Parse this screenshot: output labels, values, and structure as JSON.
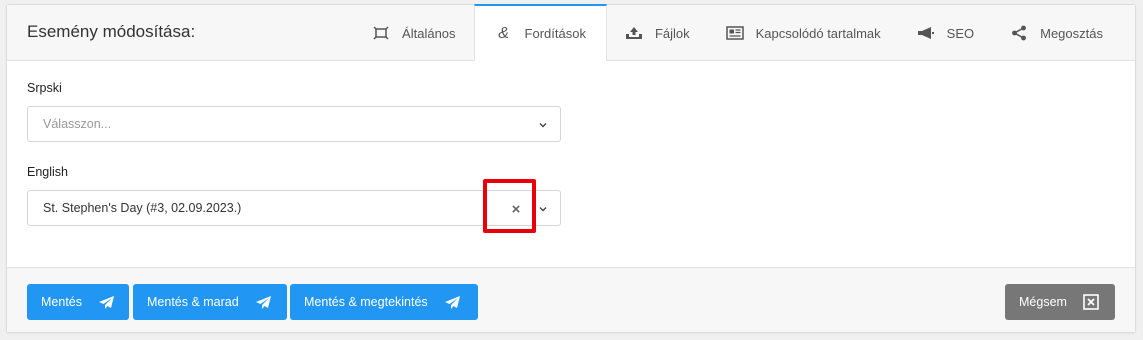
{
  "header": {
    "title": "Esemény módosítása:",
    "tabs": [
      {
        "label": "Általános",
        "icon": "expand-frame-icon",
        "active": false
      },
      {
        "label": "Fordítások",
        "icon": "ampersand-icon",
        "active": true
      },
      {
        "label": "Fájlok",
        "icon": "upload-icon",
        "active": false
      },
      {
        "label": "Kapcsolódó tartalmak",
        "icon": "newspaper-icon",
        "active": false
      },
      {
        "label": "SEO",
        "icon": "megaphone-icon",
        "active": false
      },
      {
        "label": "Megosztás",
        "icon": "share-icon",
        "active": false
      }
    ]
  },
  "form": {
    "serbian": {
      "label": "Srpski",
      "placeholder": "Válasszon..."
    },
    "english": {
      "label": "English",
      "value": "St. Stephen's Day (#3, 02.09.2023.)",
      "clear_symbol": "×"
    }
  },
  "footer": {
    "save_label": "Mentés",
    "save_stay_label": "Mentés & marad",
    "save_view_label": "Mentés & megtekintés",
    "cancel_label": "Mégsem"
  },
  "colors": {
    "primary": "#2196f3",
    "cancel": "#777777",
    "highlight": "#e8000b"
  }
}
